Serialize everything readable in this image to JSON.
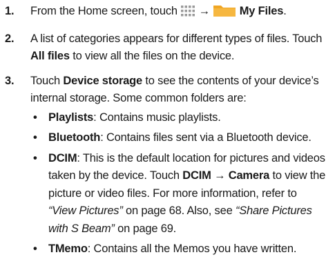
{
  "steps": [
    {
      "number": "1.",
      "pre": "From the Home screen, touch ",
      "arrow": "→",
      "bold": "My Files",
      "end": "."
    },
    {
      "number": "2.",
      "pre": "A list of categories appears for different types of files. Touch ",
      "bold": "All files",
      "post": " to view all the files on the device."
    },
    {
      "number": "3.",
      "pre": "Touch ",
      "bold": "Device storage",
      "post": " to see the contents of your device’s internal storage. Some common folders are:"
    }
  ],
  "folders": [
    {
      "bullet": "•",
      "name": "Playlists",
      "desc": ": Contains music playlists."
    },
    {
      "bullet": "•",
      "name": "Bluetooth",
      "desc": ": Contains files sent via a Bluetooth device."
    },
    {
      "bullet": "•",
      "name": "DCIM",
      "desc1": ": This is the default location for pictures and videos taken by the device. Touch ",
      "bold2": "DCIM",
      "arrow": "→",
      "bold3": "Camera",
      "desc2": " to view the picture or video files. For more information, refer to ",
      "ref1": "“View Pictures”",
      "desc3": " on page 68. Also, see ",
      "ref2": "“Share Pictures with S Beam”",
      "desc4": " on page 69."
    },
    {
      "bullet": "•",
      "name": "TMemo",
      "desc": ": Contains all the Memos you have written."
    }
  ],
  "colors": {
    "text": "#1a1a1a",
    "apps_icon": "#9a9a9a",
    "folder": "#f0a623"
  },
  "icons": {
    "apps": "apps-grid-icon",
    "folder": "my-files-folder-icon"
  }
}
